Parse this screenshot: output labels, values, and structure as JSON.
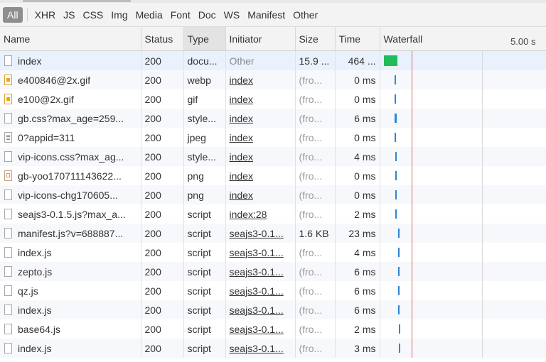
{
  "filters": [
    "All",
    "XHR",
    "JS",
    "CSS",
    "Img",
    "Media",
    "Font",
    "Doc",
    "WS",
    "Manifest",
    "Other"
  ],
  "columns": {
    "name": "Name",
    "status": "Status",
    "type": "Type",
    "initiator": "Initiator",
    "size": "Size",
    "time": "Time",
    "waterfall": "Waterfall",
    "waterfall_scale": "5.00 s"
  },
  "rows": [
    {
      "icon": "document-icon",
      "name": "index",
      "status": "200",
      "type": "docu...",
      "initiator": "Other",
      "initiator_link": false,
      "size": "15.9 ...",
      "size_dim": false,
      "time": "464 ...",
      "wf_start": 0.02,
      "wf_len": 0.08,
      "wf_kind": "doc"
    },
    {
      "icon": "image-icon",
      "name": "e400846@2x.gif",
      "status": "200",
      "type": "webp",
      "initiator": "index",
      "initiator_link": true,
      "size": "(fro...",
      "size_dim": true,
      "time": "0 ms",
      "wf_start": 0.085,
      "wf_len": 0.008,
      "wf_kind": "res"
    },
    {
      "icon": "image-icon",
      "name": "e100@2x.gif",
      "status": "200",
      "type": "gif",
      "initiator": "index",
      "initiator_link": true,
      "size": "(fro...",
      "size_dim": true,
      "time": "0 ms",
      "wf_start": 0.085,
      "wf_len": 0.008,
      "wf_kind": "res"
    },
    {
      "icon": "file-icon",
      "name": "gb.css?max_age=259...",
      "status": "200",
      "type": "style...",
      "initiator": "index",
      "initiator_link": true,
      "size": "(fro...",
      "size_dim": true,
      "time": "6 ms",
      "wf_start": 0.085,
      "wf_len": 0.012,
      "wf_kind": "res"
    },
    {
      "icon": "lines-icon",
      "name": "0?appid=311",
      "status": "200",
      "type": "jpeg",
      "initiator": "index",
      "initiator_link": true,
      "size": "(fro...",
      "size_dim": true,
      "time": "0 ms",
      "wf_start": 0.085,
      "wf_len": 0.008,
      "wf_kind": "res"
    },
    {
      "icon": "file-icon",
      "name": "vip-icons.css?max_ag...",
      "status": "200",
      "type": "style...",
      "initiator": "index",
      "initiator_link": true,
      "size": "(fro...",
      "size_dim": true,
      "time": "4 ms",
      "wf_start": 0.088,
      "wf_len": 0.01,
      "wf_kind": "res"
    },
    {
      "icon": "picture-icon",
      "name": "gb-yoo170711143622...",
      "status": "200",
      "type": "png",
      "initiator": "index",
      "initiator_link": true,
      "size": "(fro...",
      "size_dim": true,
      "time": "0 ms",
      "wf_start": 0.09,
      "wf_len": 0.008,
      "wf_kind": "res"
    },
    {
      "icon": "file-icon",
      "name": "vip-icons-chg170605...",
      "status": "200",
      "type": "png",
      "initiator": "index",
      "initiator_link": true,
      "size": "(fro...",
      "size_dim": true,
      "time": "0 ms",
      "wf_start": 0.09,
      "wf_len": 0.008,
      "wf_kind": "res"
    },
    {
      "icon": "file-icon",
      "name": "seajs3-0.1.5.js?max_a...",
      "status": "200",
      "type": "script",
      "initiator": "index:28",
      "initiator_link": true,
      "size": "(fro...",
      "size_dim": true,
      "time": "2 ms",
      "wf_start": 0.09,
      "wf_len": 0.008,
      "wf_kind": "res"
    },
    {
      "icon": "file-icon",
      "name": "manifest.js?v=688887...",
      "status": "200",
      "type": "script",
      "initiator": "seajs3-0.1...",
      "initiator_link": true,
      "size": "1.6 KB",
      "size_dim": false,
      "time": "23 ms",
      "wf_start": 0.105,
      "wf_len": 0.01,
      "wf_kind": "res"
    },
    {
      "icon": "file-icon",
      "name": "index.js",
      "status": "200",
      "type": "script",
      "initiator": "seajs3-0.1...",
      "initiator_link": true,
      "size": "(fro...",
      "size_dim": true,
      "time": "4 ms",
      "wf_start": 0.108,
      "wf_len": 0.008,
      "wf_kind": "res"
    },
    {
      "icon": "file-icon",
      "name": "zepto.js",
      "status": "200",
      "type": "script",
      "initiator": "seajs3-0.1...",
      "initiator_link": true,
      "size": "(fro...",
      "size_dim": true,
      "time": "6 ms",
      "wf_start": 0.108,
      "wf_len": 0.008,
      "wf_kind": "res"
    },
    {
      "icon": "file-icon",
      "name": "qz.js",
      "status": "200",
      "type": "script",
      "initiator": "seajs3-0.1...",
      "initiator_link": true,
      "size": "(fro...",
      "size_dim": true,
      "time": "6 ms",
      "wf_start": 0.108,
      "wf_len": 0.008,
      "wf_kind": "res"
    },
    {
      "icon": "file-icon",
      "name": "index.js",
      "status": "200",
      "type": "script",
      "initiator": "seajs3-0.1...",
      "initiator_link": true,
      "size": "(fro...",
      "size_dim": true,
      "time": "6 ms",
      "wf_start": 0.108,
      "wf_len": 0.008,
      "wf_kind": "res"
    },
    {
      "icon": "file-icon",
      "name": "base64.js",
      "status": "200",
      "type": "script",
      "initiator": "seajs3-0.1...",
      "initiator_link": true,
      "size": "(fro...",
      "size_dim": true,
      "time": "2 ms",
      "wf_start": 0.11,
      "wf_len": 0.008,
      "wf_kind": "res"
    },
    {
      "icon": "file-icon",
      "name": "index.js",
      "status": "200",
      "type": "script",
      "initiator": "seajs3-0.1...",
      "initiator_link": true,
      "size": "(fro...",
      "size_dim": true,
      "time": "3 ms",
      "wf_start": 0.11,
      "wf_len": 0.008,
      "wf_kind": "res"
    }
  ],
  "waterfall": {
    "redline": 0.19,
    "gridline": 0.61
  }
}
